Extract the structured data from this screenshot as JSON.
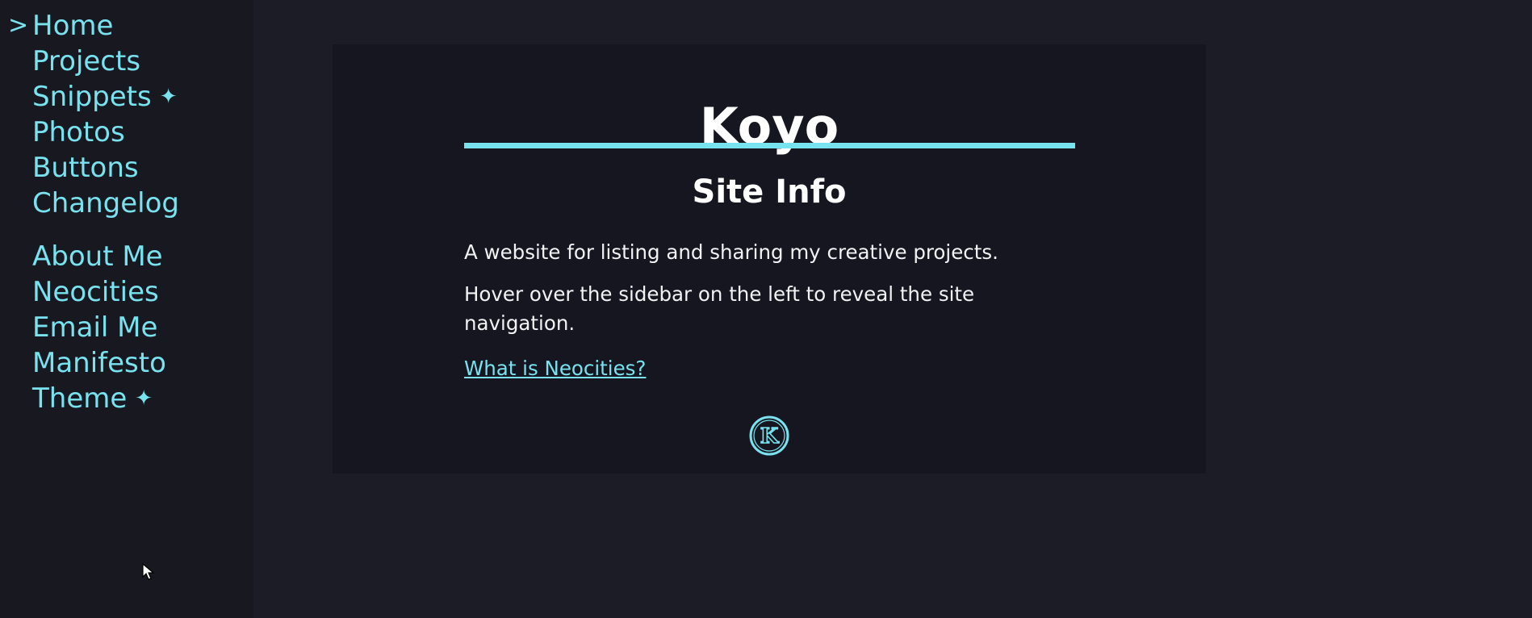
{
  "sidebar": {
    "current_marker": ">",
    "primary_items": [
      {
        "label": "Home",
        "current": true,
        "star": false
      },
      {
        "label": "Projects",
        "current": false,
        "star": false
      },
      {
        "label": "Snippets",
        "current": false,
        "star": true
      },
      {
        "label": "Photos",
        "current": false,
        "star": false
      },
      {
        "label": "Buttons",
        "current": false,
        "star": false
      },
      {
        "label": "Changelog",
        "current": false,
        "star": false
      }
    ],
    "secondary_items": [
      {
        "label": "About Me",
        "star": false
      },
      {
        "label": "Neocities",
        "star": false
      },
      {
        "label": "Email Me",
        "star": false
      },
      {
        "label": "Manifesto",
        "star": false
      },
      {
        "label": "Theme",
        "star": true
      }
    ],
    "star_glyph": "✦"
  },
  "main": {
    "site_title": "Koyo",
    "section_title": "Site Info",
    "paragraphs": [
      "A website for listing and sharing my creative projects.",
      "Hover over the sidebar on the left to reveal the site navigation."
    ],
    "link_text": "What is Neocities?",
    "logo_letter": "K"
  },
  "colors": {
    "accent": "#79e2ef",
    "page_bg": "#1c1c26",
    "sidebar_bg": "#171820",
    "card_bg": "#15161f",
    "text": "#ffffff"
  },
  "icons": {
    "logo": "k-circle-logo-icon",
    "cursor": "mouse-cursor-icon",
    "star": "sparkle-star-icon"
  }
}
